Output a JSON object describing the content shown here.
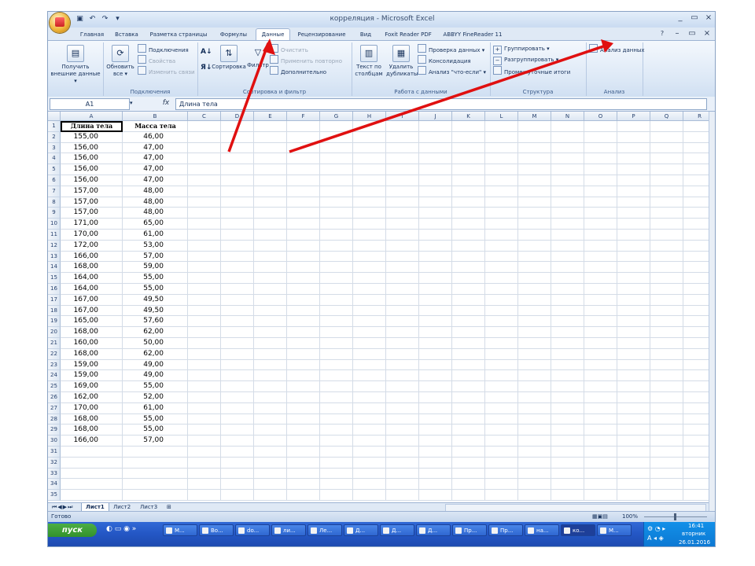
{
  "window": {
    "title": "корреляция - Microsoft Excel",
    "quick_access": [
      "save",
      "undo",
      "redo"
    ],
    "controls": [
      "_",
      "▭",
      "×"
    ]
  },
  "tabs": [
    "Главная",
    "Вставка",
    "Разметка страницы",
    "Формулы",
    "Данные",
    "Рецензирование",
    "Вид",
    "Foxit Reader PDF",
    "ABBYY FineReader 11"
  ],
  "active_tab": "Данные",
  "ribbon": {
    "get_external": "Получить внешние данные",
    "get_external_l1": "Получить",
    "get_external_l2": "внешние данные ▾",
    "refresh_l1": "Обновить",
    "refresh_l2": "все ▾",
    "connections": "Подключения",
    "properties": "Свойства",
    "edit_links": "Изменить связи",
    "group_connections": "Подключения",
    "sort": "Сортировка",
    "filter": "Фильтр",
    "clear": "Очистить",
    "reapply": "Применить повторно",
    "advanced": "Дополнительно",
    "group_sort": "Сортировка и фильтр",
    "text_to_cols_l1": "Текст по",
    "text_to_cols_l2": "столбцам",
    "remove_dup_l1": "Удалить",
    "remove_dup_l2": "дубликаты",
    "validation": "Проверка данных ▾",
    "consolidate": "Консолидация",
    "whatif": "Анализ \"что-если\" ▾",
    "group_datatools": "Работа с данными",
    "group": "Группировать ▾",
    "ungroup": "Разгруппировать ▾",
    "subtotal": "Промежуточные итоги",
    "group_outline": "Структура",
    "data_analysis": "Анализ данных",
    "group_analysis": "Анализ"
  },
  "formula_bar": {
    "name_box": "A1",
    "fx": "fx",
    "content": "Длина тела"
  },
  "columns": [
    "A",
    "B",
    "C",
    "D",
    "E",
    "F",
    "G",
    "H",
    "I",
    "J",
    "K",
    "L",
    "M",
    "N",
    "O",
    "P",
    "Q",
    "R"
  ],
  "row_count": 35,
  "headers": [
    "Длина тела",
    "Масса тела"
  ],
  "rows": [
    [
      "155,00",
      "46,00"
    ],
    [
      "156,00",
      "47,00"
    ],
    [
      "156,00",
      "47,00"
    ],
    [
      "156,00",
      "47,00"
    ],
    [
      "156,00",
      "47,00"
    ],
    [
      "157,00",
      "48,00"
    ],
    [
      "157,00",
      "48,00"
    ],
    [
      "157,00",
      "48,00"
    ],
    [
      "171,00",
      "65,00"
    ],
    [
      "170,00",
      "61,00"
    ],
    [
      "172,00",
      "53,00"
    ],
    [
      "166,00",
      "57,00"
    ],
    [
      "168,00",
      "59,00"
    ],
    [
      "164,00",
      "55,00"
    ],
    [
      "164,00",
      "55,00"
    ],
    [
      "167,00",
      "49,50"
    ],
    [
      "167,00",
      "49,50"
    ],
    [
      "165,00",
      "57,60"
    ],
    [
      "168,00",
      "62,00"
    ],
    [
      "160,00",
      "50,00"
    ],
    [
      "168,00",
      "62,00"
    ],
    [
      "159,00",
      "49,00"
    ],
    [
      "159,00",
      "49,00"
    ],
    [
      "169,00",
      "55,00"
    ],
    [
      "162,00",
      "52,00"
    ],
    [
      "170,00",
      "61,00"
    ],
    [
      "168,00",
      "55,00"
    ],
    [
      "168,00",
      "55,00"
    ],
    [
      "166,00",
      "57,00"
    ]
  ],
  "sheets": [
    "Лист1",
    "Лист2",
    "Лист3"
  ],
  "status": {
    "ready": "Готово",
    "zoom": "100%"
  },
  "taskbar": {
    "start": "пуск",
    "items": [
      "М...",
      "Во...",
      "do...",
      "ли...",
      "Ле...",
      "Д...",
      "Д...",
      "Д...",
      "Пр...",
      "Пр...",
      "на...",
      "ко...",
      "М..."
    ],
    "active_index": 11,
    "time": "16:41",
    "day": "вторник",
    "date": "26.01.2016"
  },
  "annotation_color": "#e01010"
}
